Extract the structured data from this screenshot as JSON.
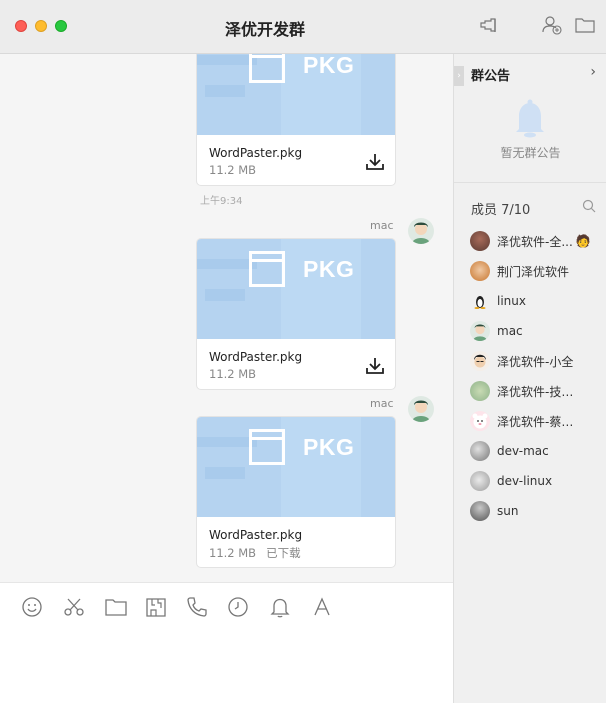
{
  "window": {
    "title": "泽优开发群"
  },
  "messages": [
    {
      "file_name": "WordPaster.pkg",
      "size": "11.2 MB",
      "thumb_label": "PKG",
      "status": ""
    },
    {
      "sender": "mac",
      "file_name": "WordPaster.pkg",
      "size": "11.2 MB",
      "thumb_label": "PKG",
      "status": ""
    },
    {
      "sender": "mac",
      "file_name": "WordPaster.pkg",
      "size": "11.2 MB",
      "thumb_label": "PKG",
      "status": "已下载"
    }
  ],
  "timestamp": "上午9:34",
  "sidebar": {
    "notice_title": "群公告",
    "notice_empty": "暂无群公告",
    "members_title": "成员 7/10",
    "members": [
      {
        "name": "泽优软件-全...",
        "badge": "🧑"
      },
      {
        "name": "荆门泽优软件"
      },
      {
        "name": "linux"
      },
      {
        "name": "mac"
      },
      {
        "name": "泽优软件-小全"
      },
      {
        "name": "泽优软件-技术..."
      },
      {
        "name": "泽优软件-蔡经理"
      },
      {
        "name": "dev-mac"
      },
      {
        "name": "dev-linux"
      },
      {
        "name": "sun"
      }
    ]
  },
  "colors": {
    "accent": "#b5d3f0",
    "close": "#fe5f57",
    "minimize": "#febc2e",
    "maximize": "#28c840"
  }
}
